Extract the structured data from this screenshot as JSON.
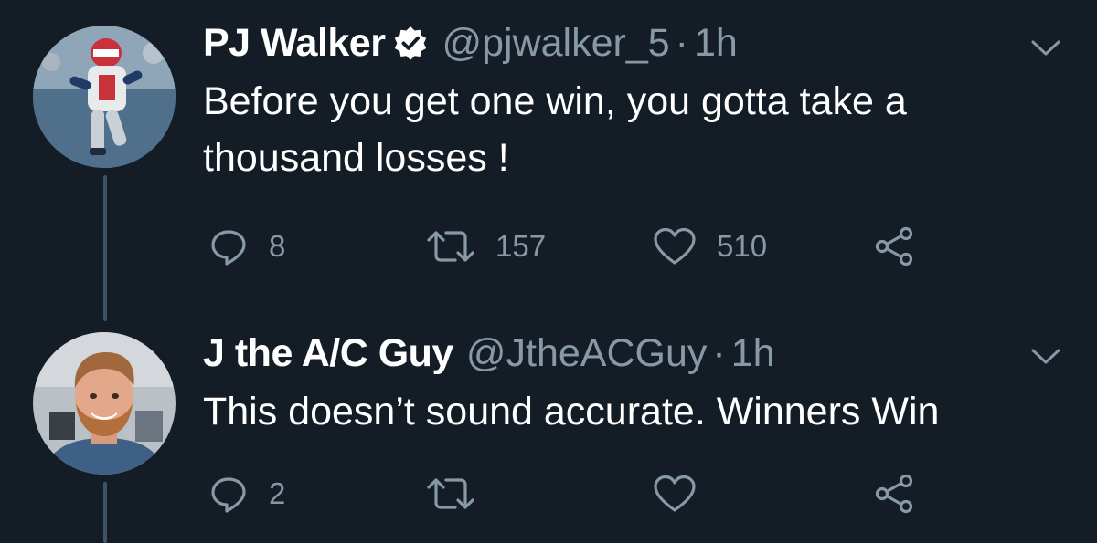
{
  "tweets": [
    {
      "display_name": "PJ Walker",
      "verified": true,
      "handle": "@pjwalker_5",
      "separator": "·",
      "time": "1h",
      "text": "Before you get one win, you gotta take a thousand losses !",
      "reply_count": "8",
      "retweet_count": "157",
      "like_count": "510",
      "avatar_icon": "football-player-avatar"
    },
    {
      "display_name": "J the A/C Guy",
      "verified": false,
      "handle": "@JtheACGuy",
      "separator": "·",
      "time": "1h",
      "text": "This doesn’t sound accurate. Winners Win",
      "reply_count": "2",
      "retweet_count": "",
      "like_count": "",
      "avatar_icon": "bearded-man-avatar"
    }
  ],
  "colors": {
    "background": "#141d26",
    "text": "#ffffff",
    "secondary": "#8899a6",
    "thread_line": "#3d5466",
    "verified_badge": "#ffffff"
  },
  "icons": {
    "reply": "reply-icon",
    "retweet": "retweet-icon",
    "like": "heart-icon",
    "share": "share-icon",
    "more": "chevron-down-icon",
    "verified": "verified-badge-icon"
  }
}
